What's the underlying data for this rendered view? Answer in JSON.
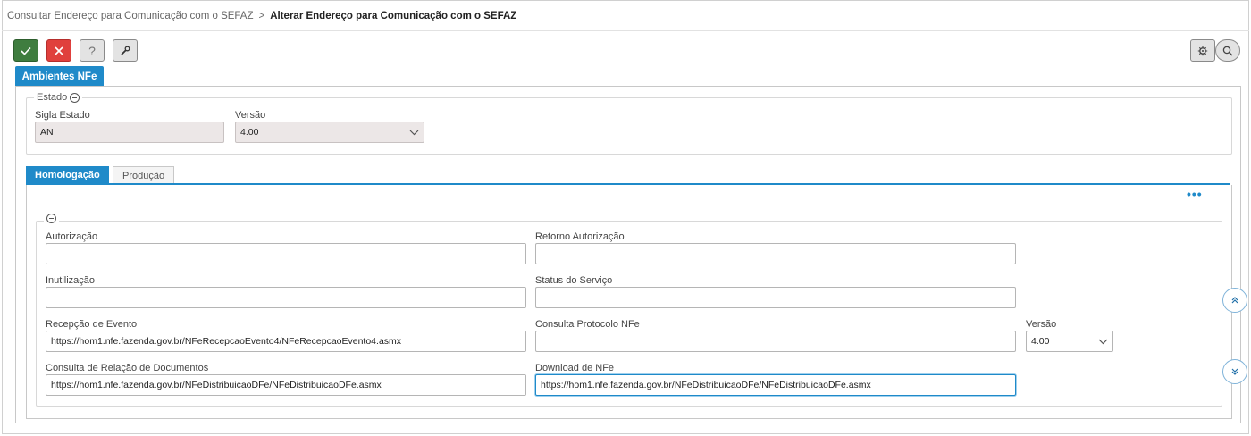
{
  "breadcrumb": {
    "parent": "Consultar Endereço para Comunicação com o SEFAZ",
    "separator": ">",
    "current": "Alterar Endereço para Comunicação com o SEFAZ"
  },
  "toolbar": {
    "confirm_icon": "check-icon",
    "cancel_icon": "close-icon",
    "help_label": "?",
    "tool_icon": "wrench-icon",
    "settings_icon": "gear-icon",
    "search_icon": "search-icon"
  },
  "env_tab": {
    "label": "Ambientes NFe"
  },
  "estado": {
    "legend": "Estado",
    "sigla_label": "Sigla Estado",
    "sigla_value": "AN",
    "versao_label": "Versão",
    "versao_value": "4.00"
  },
  "tabs": [
    {
      "label": "Homologação",
      "active": true
    },
    {
      "label": "Produção",
      "active": false
    }
  ],
  "form": {
    "autorizacao": {
      "label": "Autorização",
      "value": ""
    },
    "retorno_autorizacao": {
      "label": "Retorno Autorização",
      "value": ""
    },
    "inutilizacao": {
      "label": "Inutilização",
      "value": ""
    },
    "status_servico": {
      "label": "Status do Serviço",
      "value": ""
    },
    "recepcao_evento": {
      "label": "Recepção de Evento",
      "value": "https://hom1.nfe.fazenda.gov.br/NFeRecepcaoEvento4/NFeRecepcaoEvento4.asmx"
    },
    "consulta_protocolo": {
      "label": "Consulta Protocolo NFe",
      "value": ""
    },
    "versao": {
      "label": "Versão",
      "value": "4.00"
    },
    "consulta_relacao": {
      "label": "Consulta de Relação de Documentos",
      "value": "https://hom1.nfe.fazenda.gov.br/NFeDistribuicaoDFe/NFeDistribuicaoDFe.asmx"
    },
    "download_nfe": {
      "label": "Download de NFe",
      "value": "https://hom1.nfe.fazenda.gov.br/NFeDistribuicaoDFe/NFeDistribuicaoDFe.asmx"
    }
  },
  "colors": {
    "accent": "#1f8ac9",
    "confirm": "#3f7d3f",
    "cancel": "#e0403d"
  }
}
